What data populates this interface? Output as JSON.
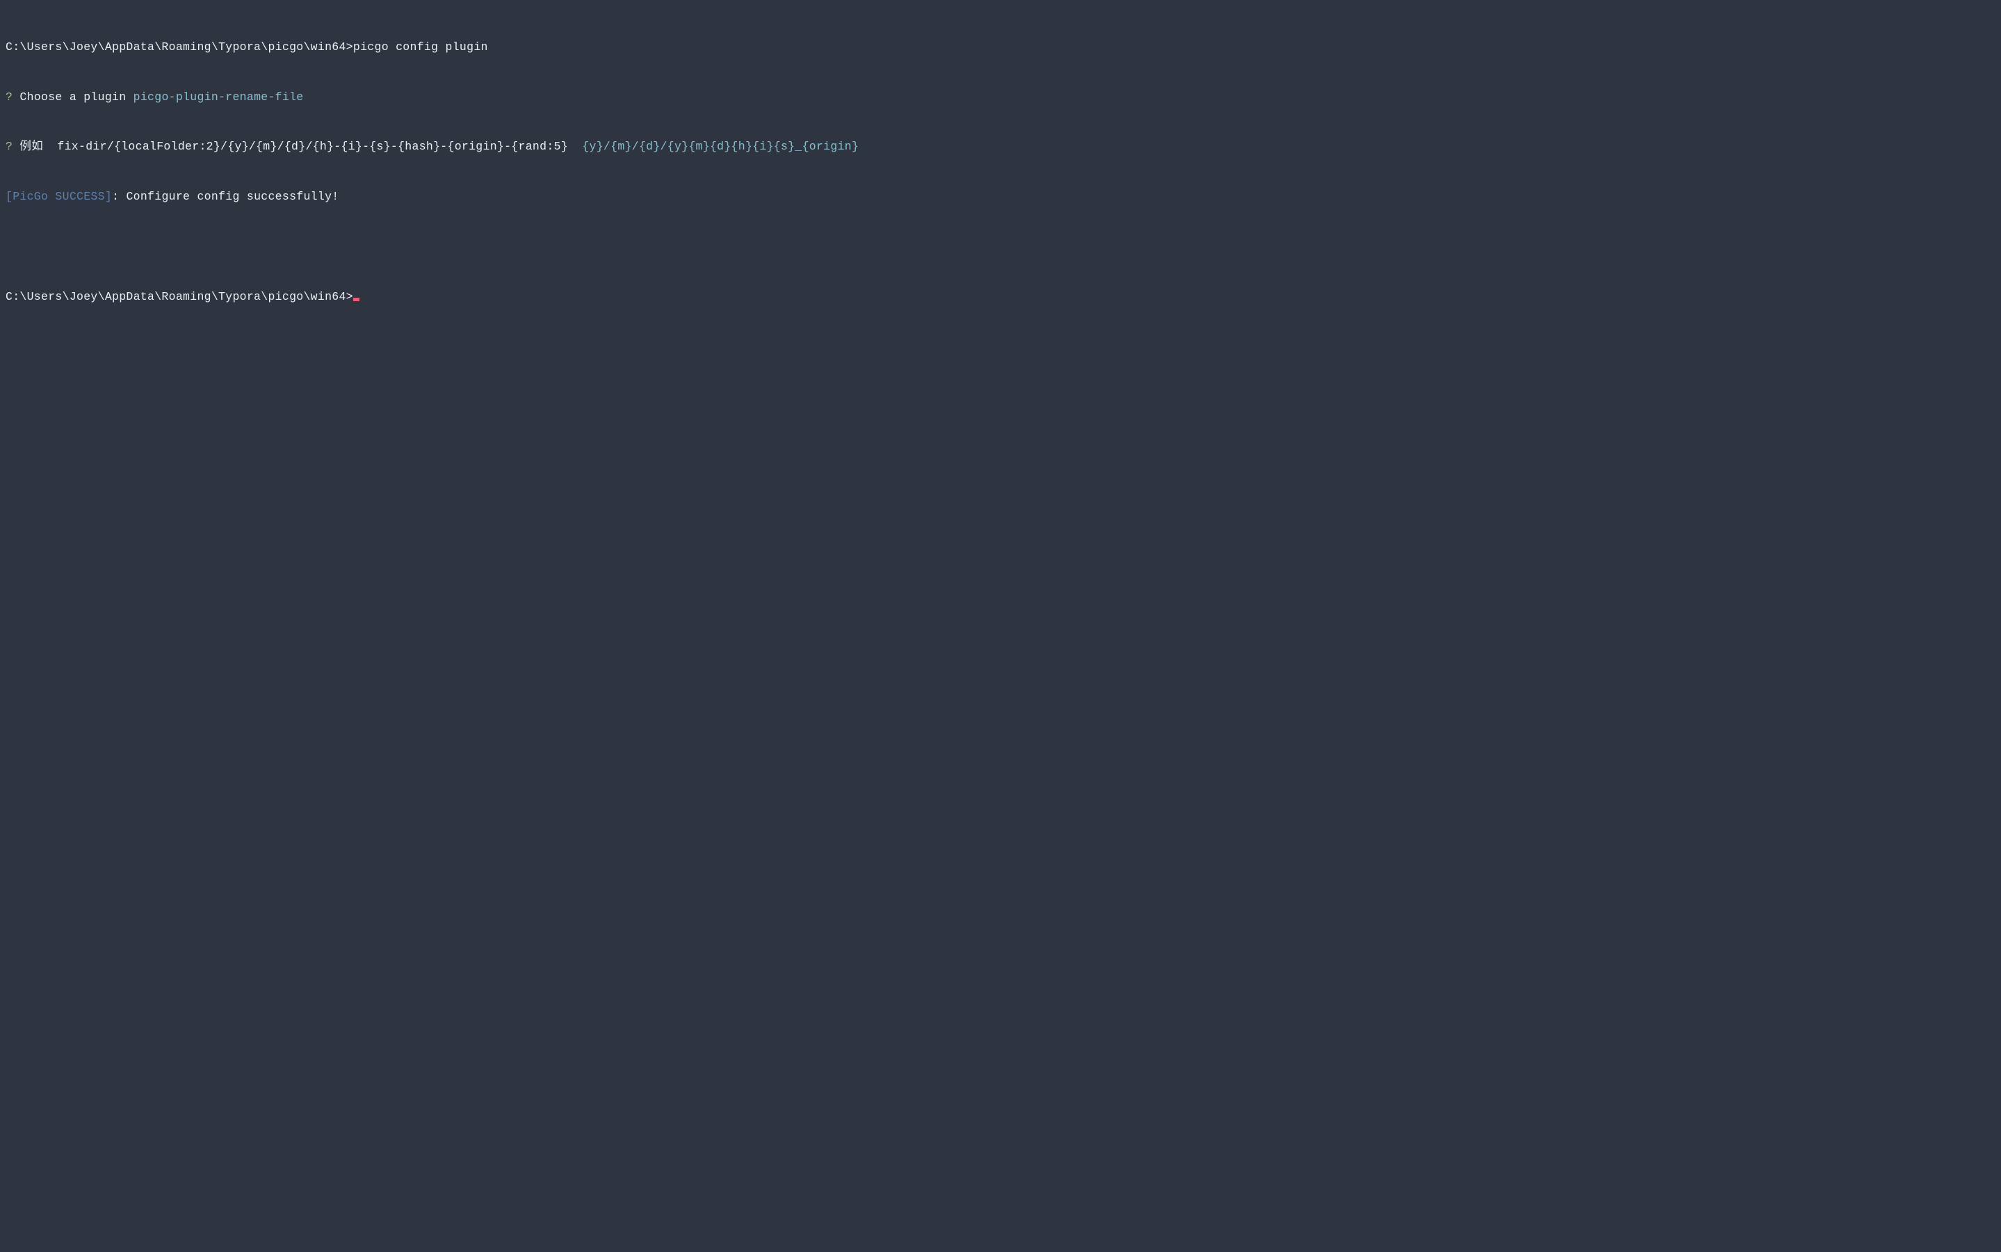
{
  "terminal": {
    "line1": {
      "prompt": "C:\\Users\\Joey\\AppData\\Roaming\\Typora\\picgo\\win64>",
      "command": "picgo config plugin"
    },
    "line2": {
      "question": "?",
      "text": " Choose a plugin ",
      "answer": "picgo-plugin-rename-file"
    },
    "line3": {
      "question": "?",
      "text": " 例如  fix-dir/{localFolder:2}/{y}/{m}/{d}/{h}-{i}-{s}-{hash}-{origin}-{rand:5} ",
      "answer": " {y}/{m}/{d}/{y}{m}{d}{h}{i}{s}_{origin}"
    },
    "line4": {
      "status": "[PicGo SUCCESS]",
      "colon": ": ",
      "message": "Configure config successfully!"
    },
    "line5": {
      "prompt": "C:\\Users\\Joey\\AppData\\Roaming\\Typora\\picgo\\win64>"
    }
  }
}
